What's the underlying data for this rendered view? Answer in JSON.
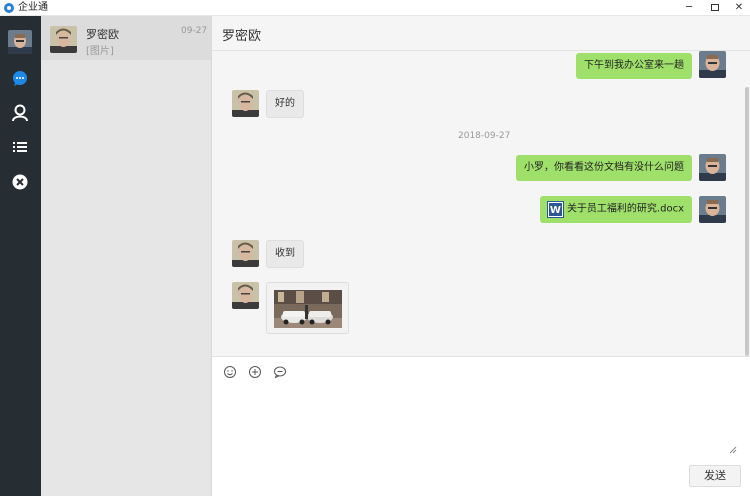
{
  "window": {
    "title": "企业通",
    "controls": {
      "minimize": "─",
      "close": "✕"
    }
  },
  "nav": {
    "items": [
      {
        "name": "chat-icon",
        "active": true
      },
      {
        "name": "contacts-icon"
      },
      {
        "name": "list-icon"
      },
      {
        "name": "close-icon"
      }
    ]
  },
  "conversations": [
    {
      "name": "罗密欧",
      "preview": "[图片]",
      "time": "09-27"
    }
  ],
  "chat": {
    "title": "罗密欧",
    "messages": [
      {
        "dir": "out",
        "text": "下午到我办公室来一趟"
      },
      {
        "dir": "in",
        "text": "好的"
      },
      {
        "type": "date",
        "text": "2018-09-27"
      },
      {
        "dir": "out",
        "text": "小罗，你看看这份文档有没什么问题"
      },
      {
        "dir": "out",
        "type": "file",
        "file_icon": "W",
        "text": "关于员工福利的研究.docx"
      },
      {
        "dir": "in",
        "text": "收到"
      },
      {
        "dir": "in",
        "type": "image"
      }
    ]
  },
  "composer": {
    "tools": [
      "emoji-icon",
      "plus-icon",
      "chat-bubble-icon"
    ],
    "input_value": "",
    "send_label": "发送"
  },
  "colors": {
    "nav_bg": "#262d33",
    "accent": "#2a7fd4",
    "bubble_out": "#9fe06a",
    "bubble_in": "#e9e9e9"
  }
}
